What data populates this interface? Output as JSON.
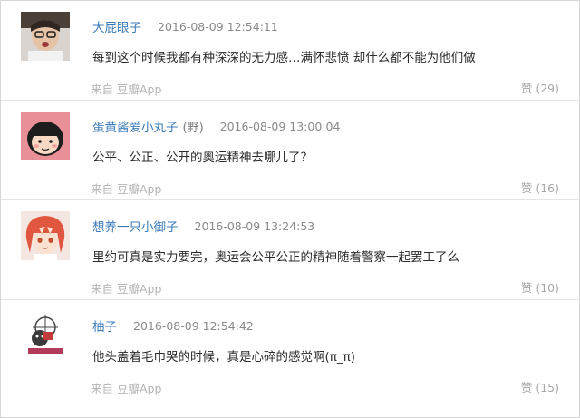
{
  "comments": [
    {
      "username": "大屁眼子",
      "suffix": "",
      "time": "2016-08-09 12:54:11",
      "text": "每到这个时候我都有种深深的无力感…满怀悲愤 却什么都不能为他们做",
      "source": "来自 豆瓣App",
      "like_label": "赞",
      "like_count": "(29)"
    },
    {
      "username": "蛋黄酱爱小丸子",
      "suffix": "(野)",
      "time": "2016-08-09 13:00:04",
      "text": "公平、公正、公开的奥运精神去哪儿了？",
      "source": "来自 豆瓣App",
      "like_label": "赞",
      "like_count": "(16)"
    },
    {
      "username": "想养一只小御子",
      "suffix": "",
      "time": "2016-08-09 13:24:53",
      "text": "里约可真是实力要完，奥运会公平公正的精神随着警察一起罢工了么",
      "source": "来自 豆瓣App",
      "like_label": "赞",
      "like_count": "(10)"
    },
    {
      "username": "柚子",
      "suffix": "",
      "time": "2016-08-09 12:54:42",
      "text": "他头盖着毛巾哭的时候，真是心碎的感觉啊(π_π)",
      "source": "来自 豆瓣App",
      "like_label": "赞",
      "like_count": "(15)"
    }
  ],
  "colors": {
    "username": "#3a7bb8",
    "text": "#2b2b2b",
    "meta": "#b3b3b3",
    "divider": "#e4e4e4"
  },
  "icons": [
    "avatar-photo-boy",
    "avatar-cartoon-girl",
    "avatar-anime-redhair",
    "avatar-mascot"
  ]
}
